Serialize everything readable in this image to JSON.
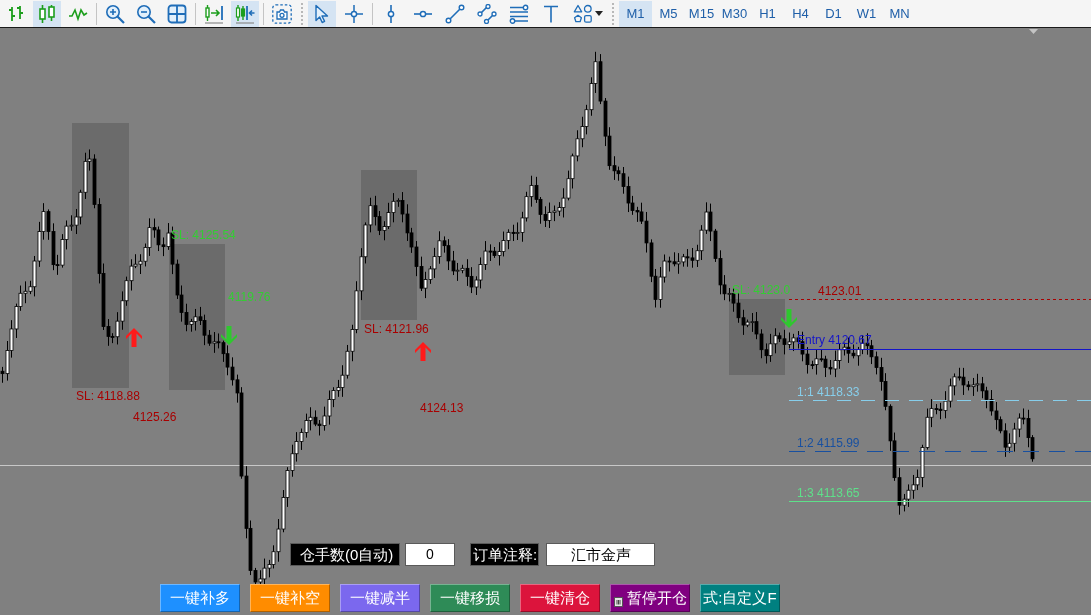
{
  "toolbar": {
    "toolbars": [
      {
        "groups": [
          [
            {
              "kind": "bars",
              "selected": false
            },
            {
              "kind": "candles",
              "selected": true
            },
            {
              "kind": "line",
              "selected": false
            }
          ],
          [
            {
              "kind": "zoom_in",
              "selected": false
            },
            {
              "kind": "zoom_out",
              "selected": false
            },
            {
              "kind": "tile",
              "selected": false
            }
          ],
          [
            {
              "kind": "autoscroll",
              "selected": false
            },
            {
              "kind": "chart_shift",
              "selected": true
            }
          ],
          [
            {
              "kind": "screenshot",
              "selected": false
            }
          ]
        ]
      },
      {
        "groups": [
          [
            {
              "kind": "cursor",
              "selected": true
            },
            {
              "kind": "crosshair",
              "selected": false
            }
          ],
          [
            {
              "kind": "vline",
              "selected": false
            },
            {
              "kind": "hline",
              "selected": false
            },
            {
              "kind": "trendline",
              "selected": false
            },
            {
              "kind": "channel",
              "selected": false
            },
            {
              "kind": "fibo",
              "selected": false
            },
            {
              "kind": "text",
              "selected": false
            },
            {
              "kind": "shapes",
              "selected": false
            }
          ]
        ]
      }
    ],
    "timeframes": [
      {
        "label": "M1",
        "selected": true
      },
      {
        "label": "M5",
        "selected": false
      },
      {
        "label": "M15",
        "selected": false
      },
      {
        "label": "M30",
        "selected": false
      },
      {
        "label": "H1",
        "selected": false
      },
      {
        "label": "H4",
        "selected": false
      },
      {
        "label": "D1",
        "selected": false
      },
      {
        "label": "W1",
        "selected": false
      },
      {
        "label": "MN",
        "selected": false
      }
    ]
  },
  "chart": {
    "labels": [
      {
        "text": "SL: 4125.54",
        "color": "#33cc33"
      },
      {
        "text": "4119.76",
        "color": "#33cc33"
      },
      {
        "text": "SL: 4118.88",
        "color": "#a80000"
      },
      {
        "text": "4125.26",
        "color": "#a80000"
      },
      {
        "text": "SL: 4121.96",
        "color": "#a80000"
      },
      {
        "text": "4124.13",
        "color": "#a80000"
      },
      {
        "text": "SL: 4123.0",
        "color": "#33cc33"
      }
    ],
    "levels": [
      {
        "label": "4123.01",
        "color": "#a80000",
        "dashed": true
      },
      {
        "label": "Entry 4120.67",
        "color": "#1414c8",
        "dashed": false
      },
      {
        "label": "1:1 4118.33",
        "color": "#87ceeb",
        "dashed": true
      },
      {
        "label": "1:2 4115.99",
        "color": "#1850a0",
        "dashed": true
      },
      {
        "label": "1:3 4113.65",
        "color": "#5ee08a",
        "dashed": false
      }
    ]
  },
  "order_panel": {
    "lots_label": "仓手数(0自动)",
    "lots_value": "0",
    "comment_label": "订单注释:",
    "comment_value": "汇市金声"
  },
  "buttons": [
    {
      "label": "一键补多",
      "color": "#1e90ff",
      "kind": "plain"
    },
    {
      "label": "一键补空",
      "color": "#ff8c00",
      "kind": "plain"
    },
    {
      "label": "一键减半",
      "color": "#7b68ee",
      "kind": "plain"
    },
    {
      "label": "一键移损",
      "color": "#2e8b57",
      "kind": "plain"
    },
    {
      "label": "一键清仓",
      "color": "#dc143c",
      "kind": "plain"
    },
    {
      "label": "暂停开仓",
      "color": "#800080",
      "kind": "toggle"
    },
    {
      "label": "式:自定义F",
      "color": "#008080",
      "kind": "plain"
    }
  ]
}
